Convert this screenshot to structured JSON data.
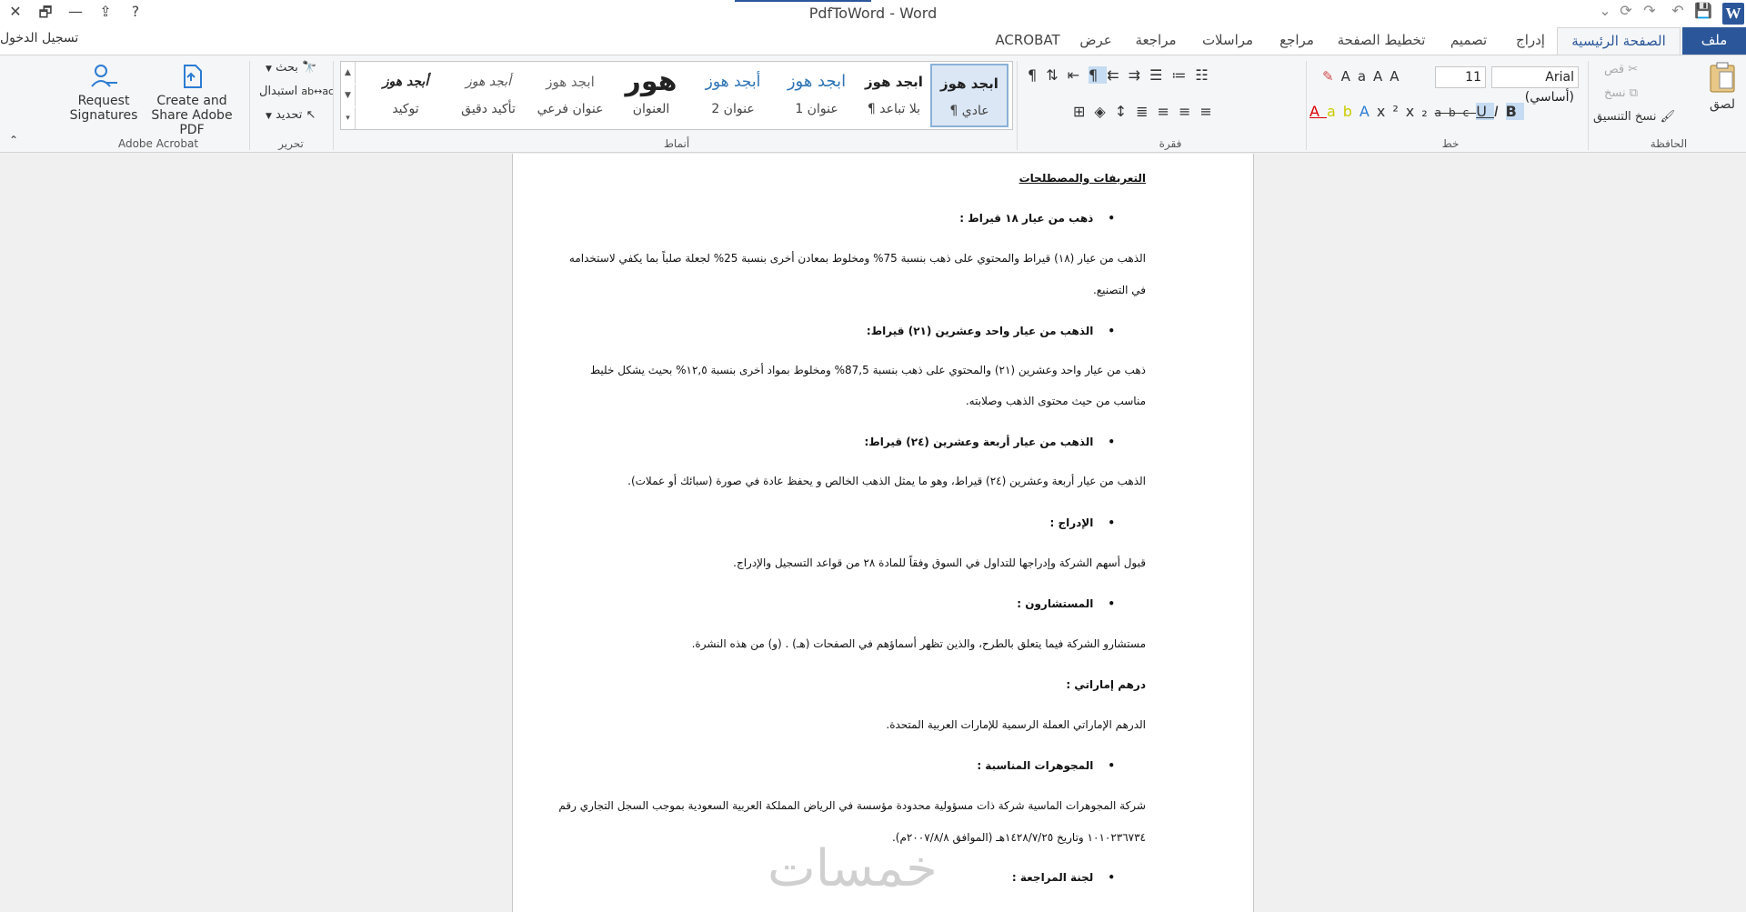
{
  "window": {
    "title": "PdfToWord - Word",
    "help": "?",
    "close": "✕",
    "restore": "🗗",
    "minimize": "—",
    "ribbon_display": "⇪"
  },
  "qat": {
    "save": "💾",
    "redo": "↷",
    "repeat": "⟳",
    "undo": "↶",
    "customize": "⌄"
  },
  "signin": "تسجيل الدخول",
  "tabs": {
    "file": "ملف",
    "home": "الصفحة الرئيسية",
    "insert": "إدراج",
    "design": "تصميم",
    "layout": "تخطيط الصفحة",
    "references": "مراجع",
    "mailings": "مراسلات",
    "review": "مراجعة",
    "view": "عرض",
    "acrobat": "ACROBAT"
  },
  "ribbon": {
    "clipboard": {
      "label": "الحافظة",
      "paste": "لصق",
      "cut": "قص",
      "copy": "نسخ",
      "format_painter": "نسخ التنسيق"
    },
    "font": {
      "label": "خط",
      "font_name": "Arial (أساسي)",
      "font_size": "11",
      "bold": "B",
      "italic": "I",
      "underline": "U",
      "strike": "abc",
      "subscript": "x₂",
      "superscript": "x²",
      "grow": "A",
      "shrink": "A",
      "case": "Aa",
      "clear": "A"
    },
    "paragraph": {
      "label": "فقرة"
    },
    "styles": {
      "label": "أنماط",
      "items": [
        {
          "sample": "ابجد هوز",
          "name": "¶ عادي"
        },
        {
          "sample": "ابجد هوز",
          "name": "¶ بلا تباعد"
        },
        {
          "sample": "ابجد هوز",
          "name": "عنوان 1"
        },
        {
          "sample": "أبجد هوز",
          "name": "عنوان 2"
        },
        {
          "sample": "هور",
          "name": "العنوان"
        },
        {
          "sample": "ابجد هوز",
          "name": "عنوان فرعي"
        },
        {
          "sample": "أبجد هوز",
          "name": "تأكيد دقيق"
        },
        {
          "sample": "أبجد هوز",
          "name": "توكيد"
        }
      ]
    },
    "editing": {
      "label": "تحرير",
      "find": "بحث",
      "replace": "استبدال",
      "select": "تحديد"
    },
    "acrobat": {
      "label": "Adobe Acrobat",
      "create_line1": "Create and",
      "create_line2": "Share Adobe PDF",
      "request_line1": "Request",
      "request_line2": "Signatures"
    },
    "collapse": "⌃"
  },
  "document": {
    "paragraphs": [
      {
        "text": "التعريفات والمصطلحات",
        "type": "title"
      },
      {
        "text": "ذهب من عيار ١٨ قيراط :",
        "type": "bullet"
      },
      {
        "text": "الذهب من عيار  (١٨) قيراط والمحتوي على ذهب بنسبة 75% ومخلوط بمعادن أخرى بنسبة 25% لجعلة صلباً بما يكفي لاستخدامه",
        "type": "body"
      },
      {
        "text": "في التصنيع.",
        "type": "body"
      },
      {
        "text": "الذهب من عيار واحد وعشرين (٢١) قيراط:",
        "type": "bullet"
      },
      {
        "text": "ذهب من عيار واحد وعشرين (٢١) والمحتوي على ذهب بنسبة 87,5%  ومخلوط بمواد أخرى بنسبة ١٢,٥% بحيث يشكل خليط",
        "type": "body"
      },
      {
        "text": "مناسب من حيث محتوى الذهب وصلابته.",
        "type": "body"
      },
      {
        "text": "الذهب من عيار أربعة وعشرين (٢٤) قيراط:",
        "type": "bullet"
      },
      {
        "text": "الذهب من عيار أربعة وعشرين (٢٤) قيراط، وهو ما يمثل الذهب الخالص و يحفظ عادة في صورة (سبائك أو عملات).",
        "type": "body"
      },
      {
        "text": "الإدراج :",
        "type": "bullet"
      },
      {
        "text": "قبول أسهم الشركة وإدراجها للتداول في السوق وفقاً للمادة ٢٨ من قواعد التسجيل والإدراج.",
        "type": "body"
      },
      {
        "text": "المستشارون :",
        "type": "bullet"
      },
      {
        "text": "مستشارو الشركة فيما يتعلق بالطرح، والذين تظهر أسماؤهم في الصفحات (هـ) . (و) من هذه النشرة.",
        "type": "body"
      },
      {
        "text": "درهم إماراتي :",
        "type": "heading"
      },
      {
        "text": "الدرهم الإماراتي العملة الرسمية للإمارات العربية المتحدة.",
        "type": "body"
      },
      {
        "text": "المجوهرات المناسبة :",
        "type": "bullet"
      },
      {
        "text": "شركة المجوهرات الماسية شركة ذات مسؤولية محدودة مؤسسة في الرياض المملكة العربية السعودية بموجب السجل التجاري رقم",
        "type": "body"
      },
      {
        "text": "١٠١٠٢٣٦٧٣٤ وتاريخ ١٤٢٨/٧/٢٥هـ (الموافق ٢٠٠٧/٨/٨م).",
        "type": "body"
      },
      {
        "text": "لجنة المراجعة :",
        "type": "bullet"
      }
    ]
  },
  "watermark": "خمسات"
}
